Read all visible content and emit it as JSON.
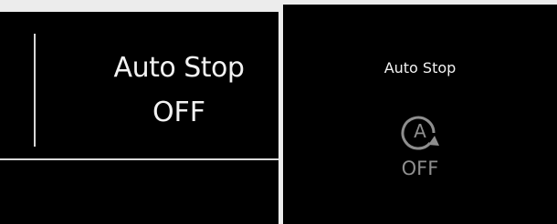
{
  "left_panel": {
    "title": "Auto Stop",
    "status": "OFF"
  },
  "right_panel": {
    "title": "Auto Stop",
    "icon": "auto-stop-icon",
    "icon_letter": "A",
    "status": "OFF"
  },
  "colors": {
    "panel_bg": "#000000",
    "text": "#f2f2f2",
    "inactive": "#8e8e8e",
    "divider": "#d8d8d8",
    "page_bg": "#ececec"
  }
}
